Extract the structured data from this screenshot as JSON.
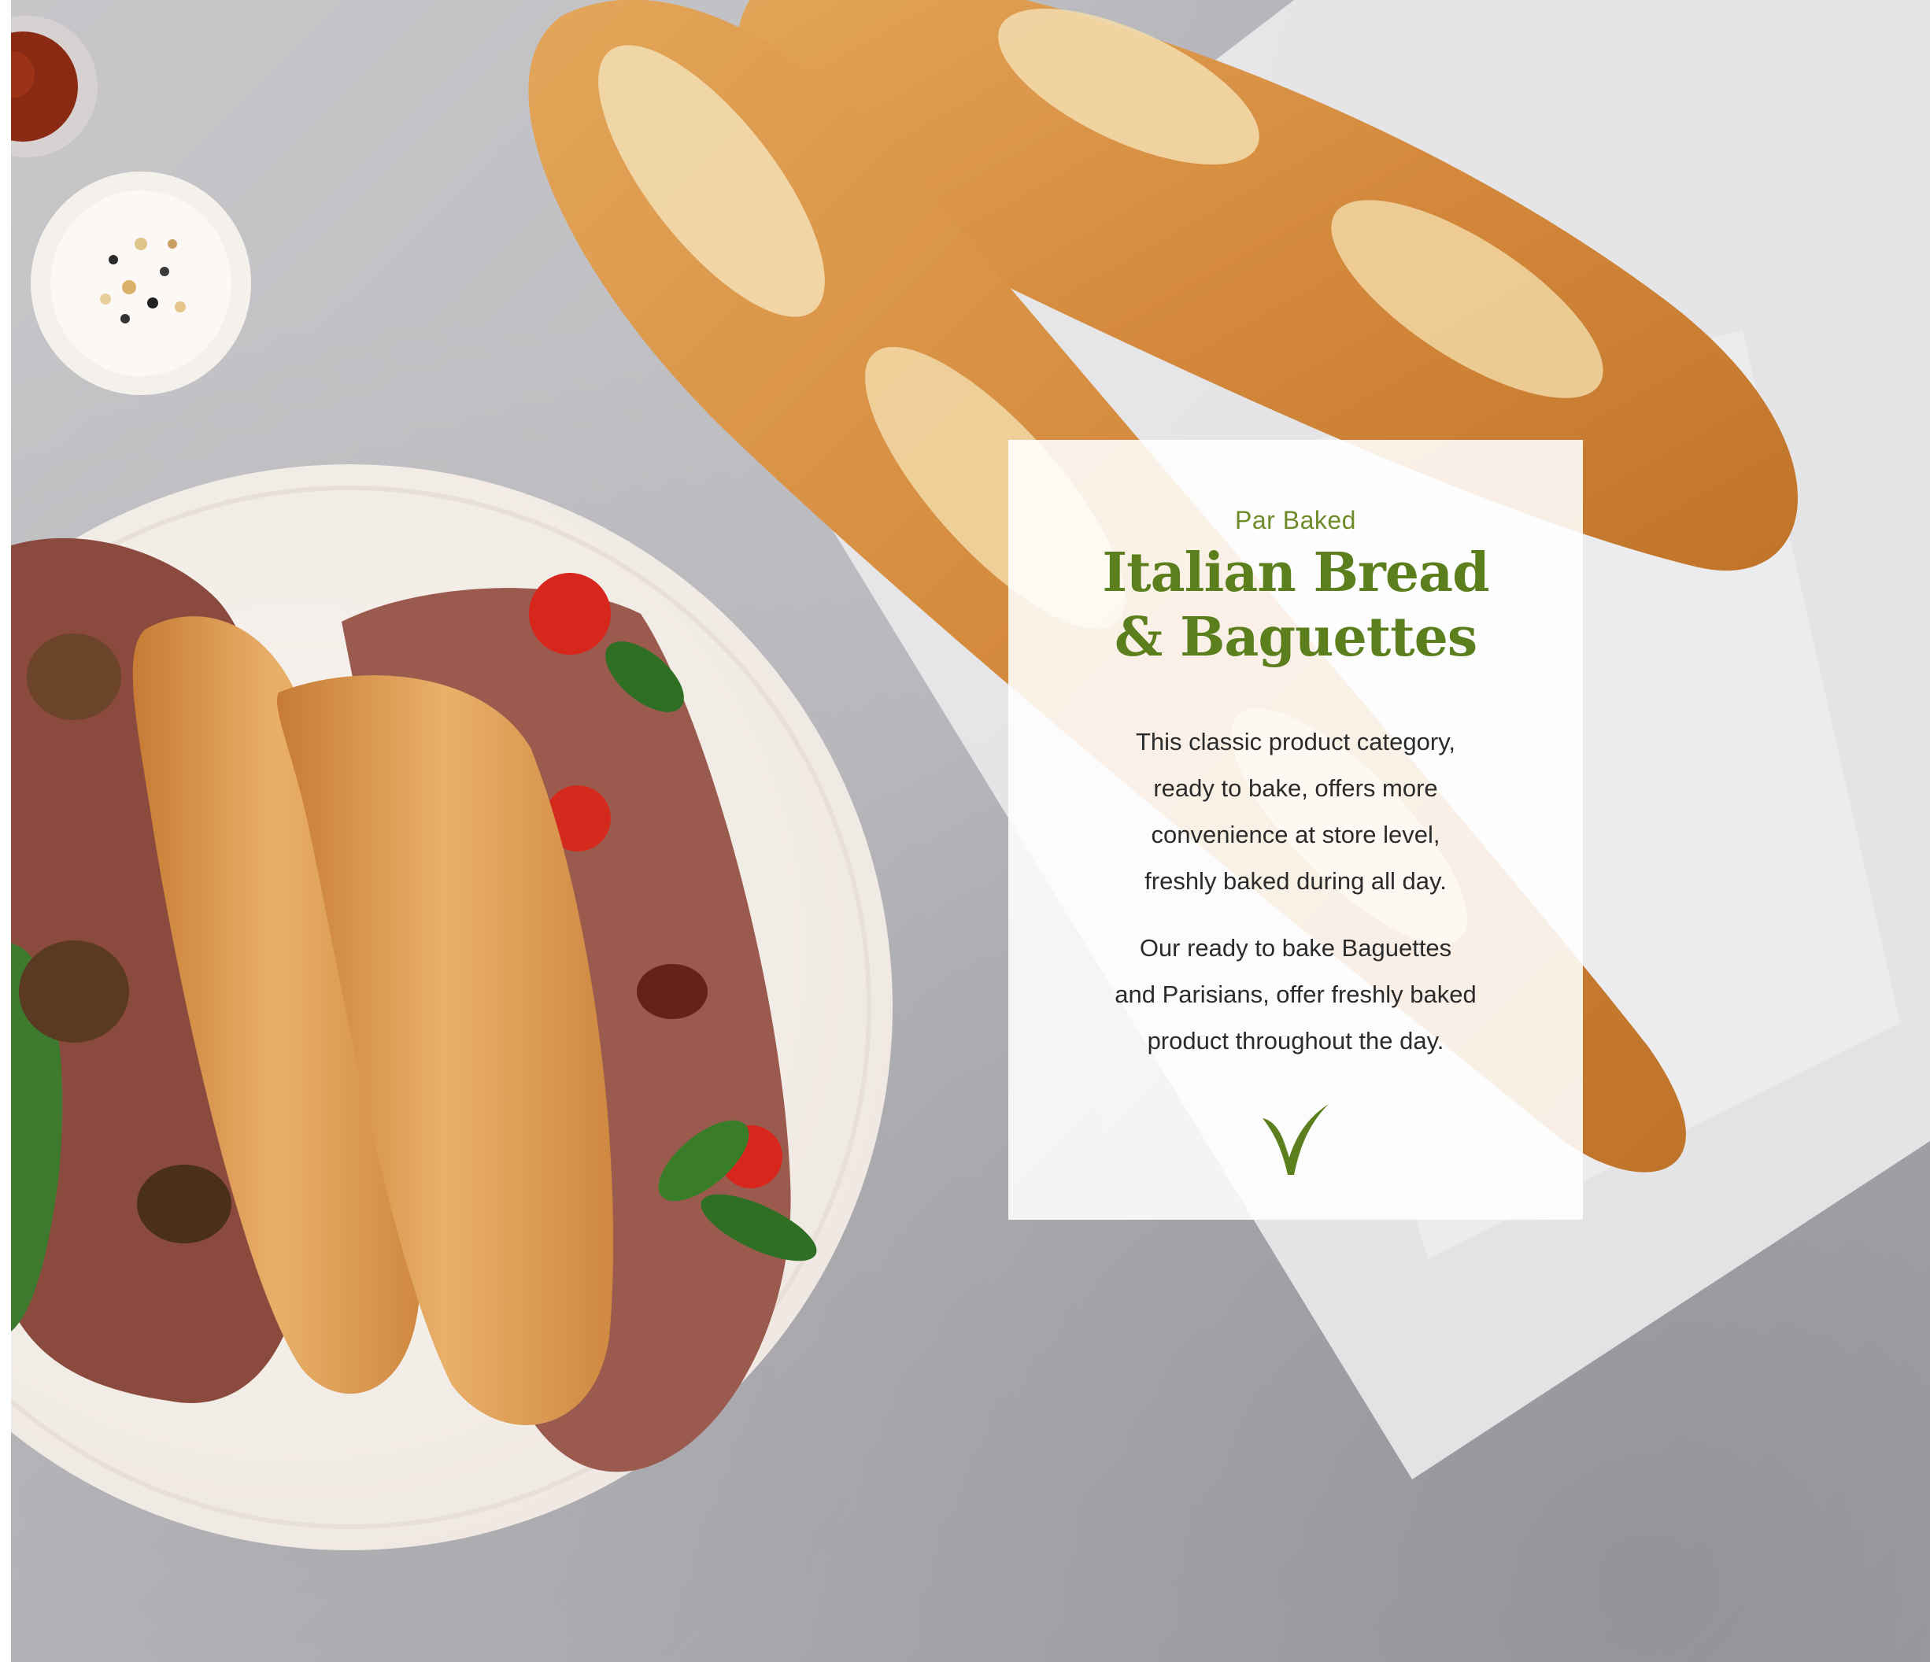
{
  "panel": {
    "eyebrow": "Par Baked",
    "title_line1": "Italian Bread",
    "title_line2": "& Baguettes",
    "paragraph1": [
      "This classic product category,",
      "ready to bake, offers more",
      "convenience at store level,",
      "freshly baked during all day."
    ],
    "paragraph2": [
      "Our ready to bake Baguettes",
      "and Parisians, offer freshly baked",
      "product throughout the day."
    ],
    "logo_icon": "checkmark-leaf-icon"
  },
  "colors": {
    "accent_green": "#5c7f1e",
    "eyebrow_green": "#6e8b2a",
    "body_text": "#2b2b2b"
  }
}
